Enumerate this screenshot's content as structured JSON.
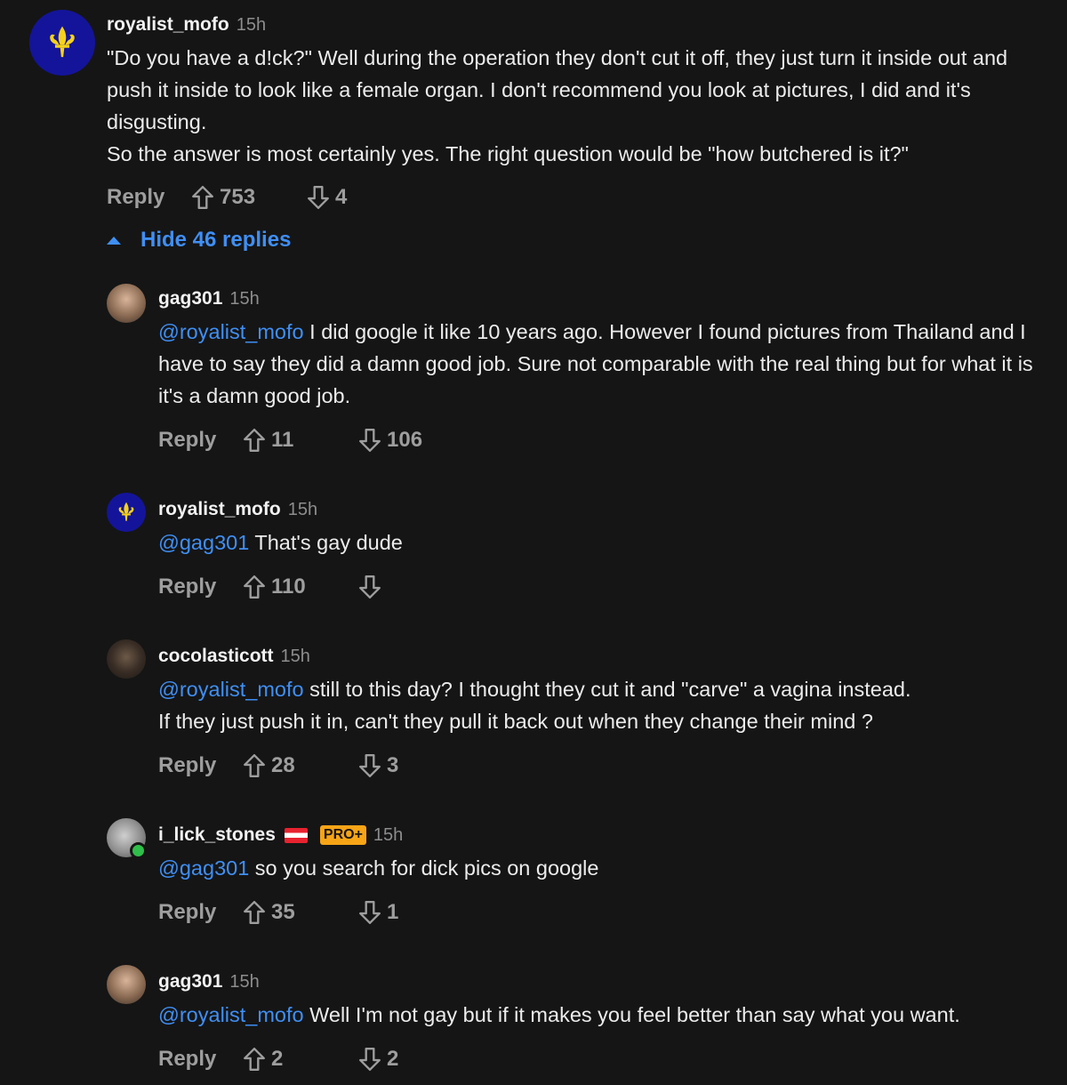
{
  "top": {
    "username": "royalist_mofo",
    "time": "15h",
    "text": "\"Do you have a d!ck?\" Well during the operation they don't cut it off, they just turn it inside out and push it inside to look like a female organ. I don't recommend you look at pictures, I did and it's disgusting.\nSo the answer is most certainly yes. The right question would be \"how butchered is it?\"",
    "reply_label": "Reply",
    "upvotes": "753",
    "downvotes": "4",
    "avatar_icon": "fleur-de-lis-icon"
  },
  "toggle_label": "Hide 46 replies",
  "replies": [
    {
      "username": "gag301",
      "time": "15h",
      "mention": "@royalist_mofo",
      "text": " I did google it like 10 years ago. However I found pictures from Thailand and I have to say they did a damn good job. Sure not comparable with the real thing but for what it is it's a damn good job.",
      "reply_label": "Reply",
      "upvotes": "11",
      "downvotes": "106"
    },
    {
      "username": "royalist_mofo",
      "time": "15h",
      "mention": "@gag301",
      "text": " That's gay dude",
      "reply_label": "Reply",
      "upvotes": "110",
      "downvotes": ""
    },
    {
      "username": "cocolasticott",
      "time": "15h",
      "mention": "@royalist_mofo",
      "text": " still to this day? I thought they cut it and \"carve\" a vagina instead.\nIf they just push it in, can't they pull it back out when they change their mind ?",
      "reply_label": "Reply",
      "upvotes": "28",
      "downvotes": "3"
    },
    {
      "username": "i_lick_stones",
      "time": "15h",
      "badge": "PRO+",
      "mention": "@gag301",
      "text": " so you search for dick pics on google",
      "reply_label": "Reply",
      "upvotes": "35",
      "downvotes": "1"
    },
    {
      "username": "gag301",
      "time": "15h",
      "mention": "@royalist_mofo",
      "text": " Well I'm not gay but if it makes you feel better than say what you want.",
      "reply_label": "Reply",
      "upvotes": "2",
      "downvotes": "2"
    }
  ],
  "colors": {
    "background": "#151515",
    "mention": "#3f8ff5",
    "badge": "#f7a416",
    "online": "#2fbf4a"
  }
}
